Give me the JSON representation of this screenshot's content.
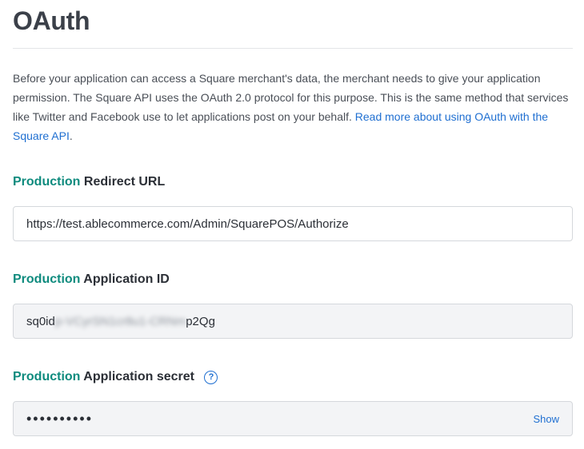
{
  "page": {
    "title": "OAuth"
  },
  "intro": {
    "text": "Before your application can access a Square merchant's data, the merchant needs to give your application permission. The Square API uses the OAuth 2.0 protocol for this purpose. This is the same method that services like Twitter and Facebook use to let applications post on your behalf. ",
    "link_text": "Read more about using OAuth with the Square API",
    "trailing": "."
  },
  "redirect_url": {
    "env": "Production",
    "label": "Redirect URL",
    "value": "https://test.ablecommerce.com/Admin/SquarePOS/Authorize"
  },
  "application_id": {
    "env": "Production",
    "label": "Application ID",
    "value_start": "sq0id",
    "value_redacted": "p-VCyrSN1cr8u1-CRNm",
    "value_end": "p2Qg"
  },
  "application_secret": {
    "env": "Production",
    "label": "Application secret",
    "help_icon": "question-circle-icon",
    "masked_value": "••••••••••",
    "show_label": "Show"
  },
  "colors": {
    "env_accent": "#0f8b7e",
    "link": "#1f6fd1"
  }
}
